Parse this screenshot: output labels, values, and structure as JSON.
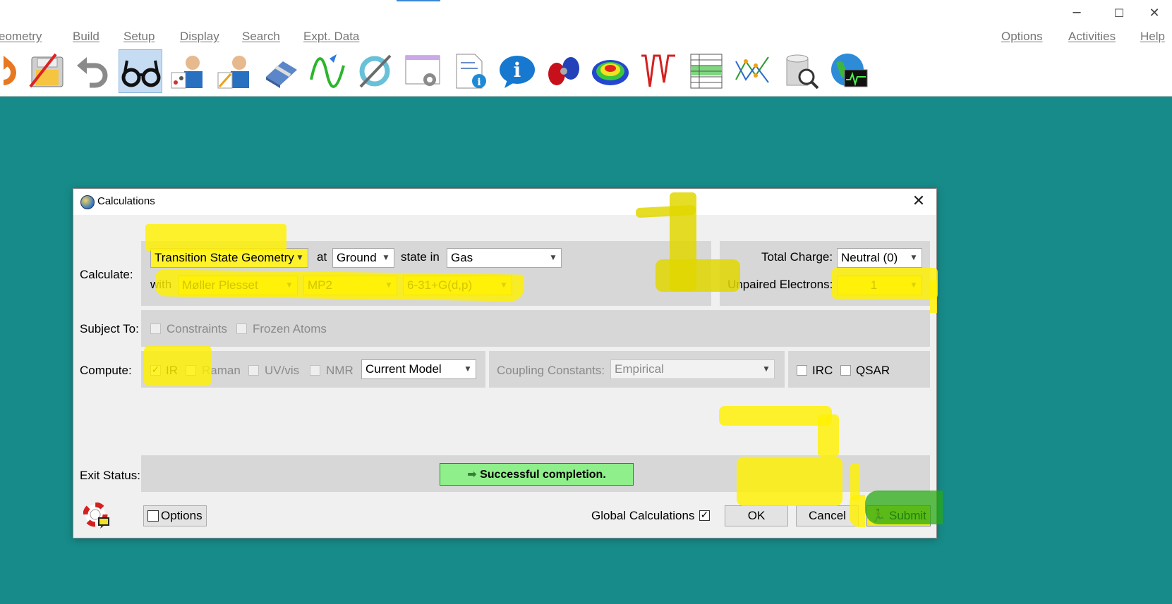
{
  "window": {
    "controls": {
      "minimize": "─",
      "maximize": "☐",
      "close": "✕"
    }
  },
  "menubar": {
    "left": [
      "eometry",
      "Build",
      "Setup",
      "Display",
      "Search",
      "Expt. Data"
    ],
    "right": [
      "Options",
      "Activities",
      "Help"
    ]
  },
  "toolbar": {
    "icons": [
      "open-file-icon",
      "save-icon",
      "undo-icon",
      "view-glasses-icon",
      "builder-icon",
      "sketch-builder-icon",
      "eraser-icon",
      "minimize-icon",
      "refresh-icon",
      "calculations-icon",
      "text-output-icon",
      "info-icon",
      "orbital-icon",
      "surface-icon",
      "spectra-icon",
      "spreadsheet-icon",
      "plot-icon",
      "database-icon",
      "web-monitor-icon"
    ]
  },
  "dialog": {
    "title": "Calculations",
    "close_symbol": "✕",
    "calculate_label": "Calculate:",
    "calc_type": "Transition State Geometry",
    "at_label": "at",
    "state": "Ground",
    "state_in_label": "state in",
    "medium": "Gas",
    "with_label": "with",
    "method": "Møller Plesset",
    "level": "MP2",
    "basis_set": "6-31+G(d,p)",
    "total_charge_label": "Total Charge:",
    "total_charge": "Neutral (0)",
    "unpaired_label": "Unpaired Electrons:",
    "unpaired": "1",
    "subject_to_label": "Subject To:",
    "constraints_label": "Constraints",
    "frozen_atoms_label": "Frozen Atoms",
    "compute_label": "Compute:",
    "ir_label": "IR",
    "ir_checked": "✓",
    "raman_label": "Raman",
    "uvvis_label": "UV/vis",
    "nmr_label": "NMR",
    "model": "Current Model",
    "coupling_label": "Coupling Constants:",
    "coupling_value": "Empirical",
    "irc_label": "IRC",
    "qsar_label": "QSAR",
    "exit_status_label": "Exit Status:",
    "exit_status": "Successful completion.",
    "options_label": "Options",
    "global_calc_label": "Global Calculations",
    "global_calc_checked": "✓",
    "ok_label": "OK",
    "cancel_label": "Cancel",
    "submit_label": "Submit"
  },
  "colors": {
    "desktop": "#178b89",
    "highlighter": "#fff22c",
    "status_ok": "#8fef8a"
  }
}
